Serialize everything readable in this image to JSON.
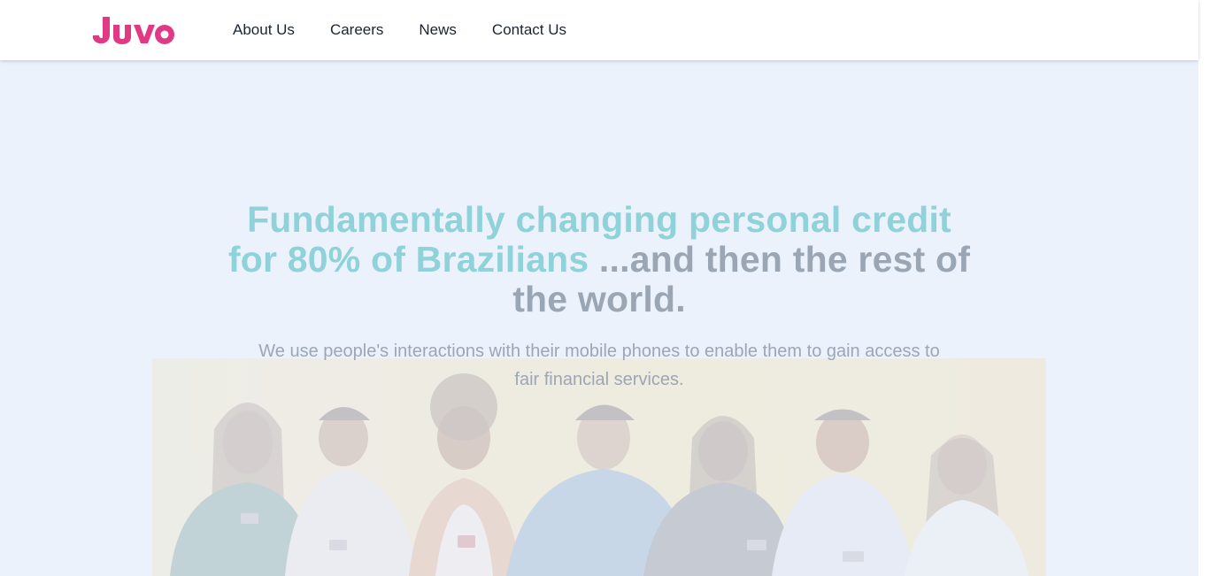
{
  "header": {
    "logo_text": "Juvo",
    "brand_color": "#e03a84",
    "nav": [
      {
        "label": "About Us"
      },
      {
        "label": "Careers"
      },
      {
        "label": "News"
      },
      {
        "label": "Contact Us"
      }
    ]
  },
  "hero": {
    "headline_accent": "Fundamentally changing personal credit for 80% of Brazilians",
    "headline_rest": " ...and then the rest of the world.",
    "subheadline": "We use people's interactions with their mobile phones to enable them to gain access to fair financial services.",
    "accent_color": "#8fd2d9",
    "muted_color": "#9ba6b4",
    "background_color": "#ecf2fc",
    "image_description_icon": "group-of-young-people-with-phones-image"
  }
}
